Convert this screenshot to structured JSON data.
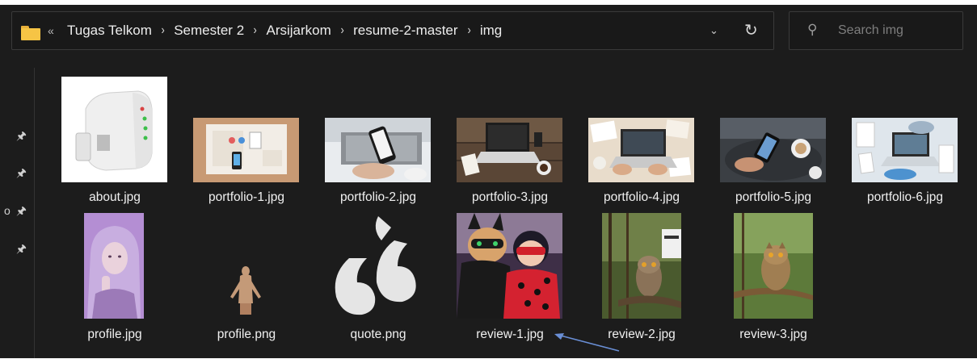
{
  "address_bar": {
    "overflow": "«",
    "breadcrumbs": [
      "Tugas Telkom",
      "Semester 2",
      "Arsijarkom",
      "resume-2-master",
      "img"
    ],
    "separator": "›",
    "dropdown_icon": "chevron-down-icon",
    "refresh_icon": "refresh-icon"
  },
  "search": {
    "placeholder": "Search img",
    "icon": "search-icon"
  },
  "nav": {
    "partial_label": "o",
    "pins": 4
  },
  "files": [
    {
      "name": "about.jpg"
    },
    {
      "name": "portfolio-1.jpg"
    },
    {
      "name": "portfolio-2.jpg"
    },
    {
      "name": "portfolio-3.jpg"
    },
    {
      "name": "portfolio-4.jpg"
    },
    {
      "name": "portfolio-5.jpg"
    },
    {
      "name": "portfolio-6.jpg"
    },
    {
      "name": "profile.jpg"
    },
    {
      "name": "profile.png"
    },
    {
      "name": "quote.png"
    },
    {
      "name": "review-1.jpg"
    },
    {
      "name": "review-2.jpg"
    },
    {
      "name": "review-3.jpg"
    }
  ],
  "colors": {
    "background": "#1c1c1c",
    "folder": "#f6c445",
    "arrow": "#6a8fd6"
  }
}
